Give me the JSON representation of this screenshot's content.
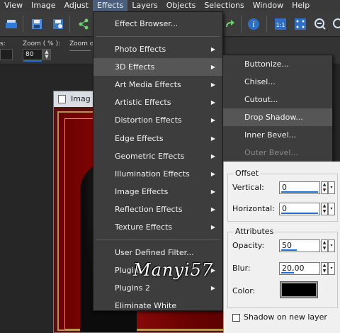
{
  "menubar": {
    "items": [
      "View",
      "Image",
      "Adjust",
      "Effects",
      "Layers",
      "Objects",
      "Selections",
      "Window",
      "Help"
    ]
  },
  "options": {
    "zoom_label": "Zoom ( % ):",
    "zoom_value": "80",
    "zoom_out_label": "Zoom ou"
  },
  "image_window": {
    "title": "Imag"
  },
  "effects_menu": {
    "items": [
      {
        "label": "Effect Browser...",
        "submenu": false
      },
      {
        "label": "Photo Effects",
        "submenu": true
      },
      {
        "label": "3D Effects",
        "submenu": true,
        "highlighted": true
      },
      {
        "label": "Art Media Effects",
        "submenu": true
      },
      {
        "label": "Artistic Effects",
        "submenu": true
      },
      {
        "label": "Distortion Effects",
        "submenu": true
      },
      {
        "label": "Edge Effects",
        "submenu": true
      },
      {
        "label": "Geometric Effects",
        "submenu": true
      },
      {
        "label": "Illumination Effects",
        "submenu": true
      },
      {
        "label": "Image Effects",
        "submenu": true
      },
      {
        "label": "Reflection Effects",
        "submenu": true
      },
      {
        "label": "Texture Effects",
        "submenu": true
      },
      {
        "label": "User Defined Filter...",
        "submenu": false
      },
      {
        "label": "Plugins",
        "submenu": true
      },
      {
        "label": "Plugins 2",
        "submenu": true
      },
      {
        "label": "Eliminate White",
        "submenu": false
      }
    ]
  },
  "effects_3d_menu": {
    "items": [
      {
        "label": "Buttonize...",
        "disabled": false
      },
      {
        "label": "Chisel...",
        "disabled": false
      },
      {
        "label": "Cutout...",
        "disabled": false
      },
      {
        "label": "Drop Shadow...",
        "disabled": false,
        "highlighted": true
      },
      {
        "label": "Inner Bevel...",
        "disabled": false
      },
      {
        "label": "Outer Bevel...",
        "disabled": true
      }
    ]
  },
  "drop_shadow": {
    "offset_title": "Offset",
    "vertical_label": "Vertical:",
    "vertical_value": "0",
    "horizontal_label": "Horizontal:",
    "horizontal_value": "0",
    "attributes_title": "Attributes",
    "opacity_label": "Opacity:",
    "opacity_value": "50",
    "blur_label": "Blur:",
    "blur_value": "20,00",
    "color_label": "Color:",
    "color_value": "#000000",
    "shadow_new_layer_label": "Shadow on new layer",
    "shadow_new_layer_checked": false
  },
  "watermark": "Manyi57",
  "colors": {
    "menu_bg": "#3d3d3d",
    "highlight": "#565656",
    "accent": "#1e6fd9",
    "canvas_red": "#8c0a0a",
    "frame_gold": "#b7924d"
  }
}
